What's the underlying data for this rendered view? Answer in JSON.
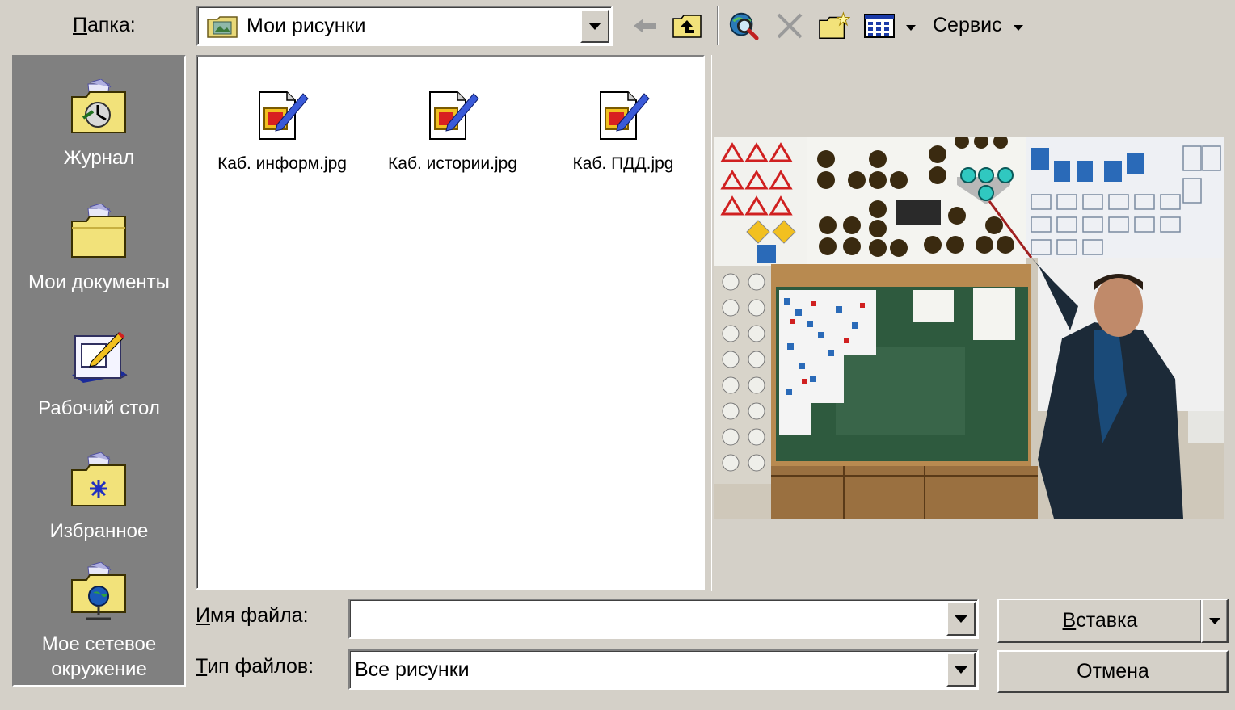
{
  "toolbar": {
    "folder_label_accel": "П",
    "folder_label_rest": "апка:",
    "folder_value": "Мои рисунки",
    "service_label": "Сервис",
    "icons": [
      "back-arrow-icon",
      "up-folder-icon",
      "search-web-icon",
      "delete-icon",
      "new-folder-icon",
      "view-menu-icon"
    ]
  },
  "places": [
    {
      "label": "Журнал",
      "icon": "history-folder-icon"
    },
    {
      "label": "Мои документы",
      "icon": "my-documents-folder-icon"
    },
    {
      "label": "Рабочий стол",
      "icon": "desktop-icon"
    },
    {
      "label": "Избранное",
      "icon": "favorites-folder-icon"
    },
    {
      "label": "Мое сетевое окружение",
      "icon": "network-places-icon"
    }
  ],
  "files": [
    {
      "name": "Каб. информ.jpg",
      "icon": "jpg-image-icon"
    },
    {
      "name": "Каб. истории.jpg",
      "icon": "jpg-image-icon"
    },
    {
      "name": "Каб. ПДД.jpg",
      "icon": "jpg-image-icon"
    }
  ],
  "filename": {
    "label_accel": "И",
    "label_rest": "мя файла:",
    "value": ""
  },
  "filetype": {
    "label_accel": "Т",
    "label_rest": "ип файлов:",
    "value": "Все рисунки"
  },
  "buttons": {
    "insert_accel": "В",
    "insert_rest": "ставка",
    "cancel": "Отмена"
  }
}
